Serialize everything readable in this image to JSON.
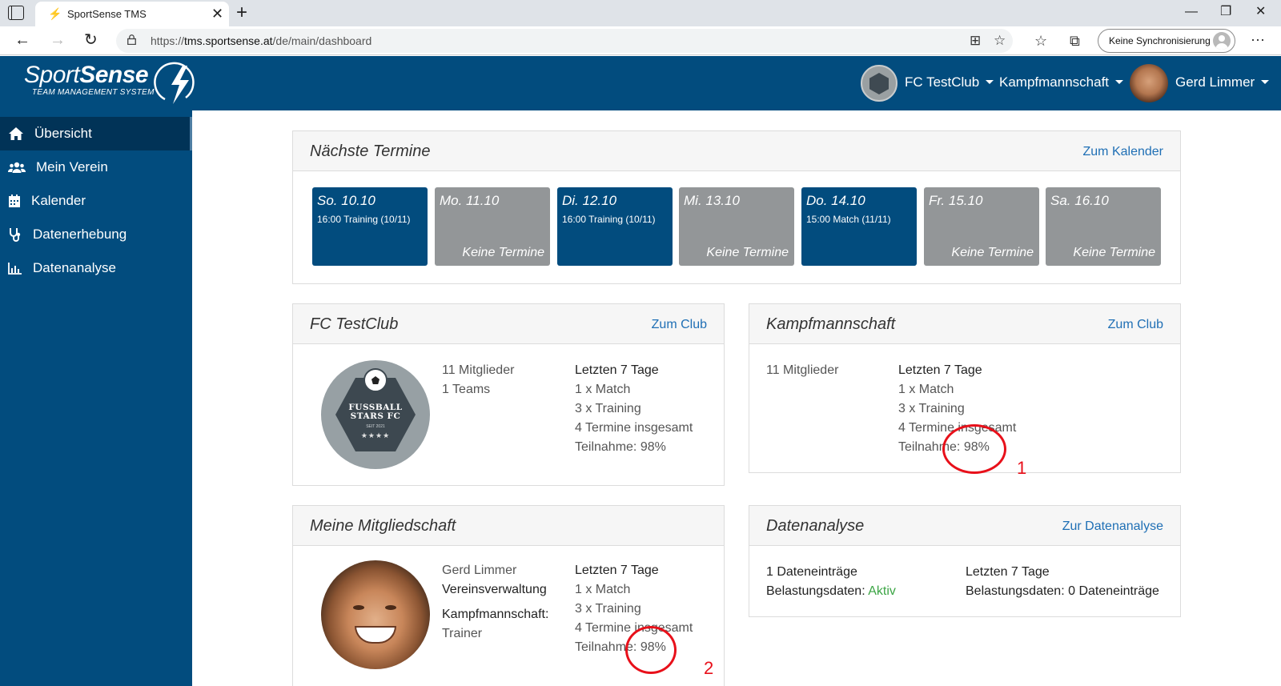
{
  "browser": {
    "tab_title": "SportSense TMS",
    "url_prefix": "https://",
    "url_host": "tms.sportsense.at",
    "url_path": "/de/main/dashboard",
    "sync_label": "Keine Synchronisierung"
  },
  "header": {
    "logo_thin": "Sport",
    "logo_bold": "Sense",
    "logo_sub": "TEAM MANAGEMENT SYSTEM",
    "club": "FC TestClub",
    "team": "Kampfmannschaft",
    "user": "Gerd Limmer"
  },
  "sidebar": {
    "items": [
      {
        "label": "Übersicht",
        "icon": "home-icon",
        "active": true
      },
      {
        "label": "Mein Verein",
        "icon": "users-icon"
      },
      {
        "label": "Kalender",
        "icon": "calendar-icon"
      },
      {
        "label": "Datenerhebung",
        "icon": "stethoscope-icon"
      },
      {
        "label": "Datenanalyse",
        "icon": "bar-chart-icon"
      }
    ]
  },
  "termine": {
    "title": "Nächste Termine",
    "link": "Zum Kalender",
    "days": [
      {
        "date": "So. 10.10",
        "event": "16:00 Training (10/11)",
        "none": ""
      },
      {
        "date": "Mo. 11.10",
        "event": "",
        "none": "Keine Termine"
      },
      {
        "date": "Di. 12.10",
        "event": "16:00 Training (10/11)",
        "none": ""
      },
      {
        "date": "Mi. 13.10",
        "event": "",
        "none": "Keine Termine"
      },
      {
        "date": "Do. 14.10",
        "event": "15:00 Match (11/11)",
        "none": ""
      },
      {
        "date": "Fr. 15.10",
        "event": "",
        "none": "Keine Termine"
      },
      {
        "date": "Sa. 16.10",
        "event": "",
        "none": "Keine Termine"
      }
    ]
  },
  "club_card": {
    "title": "FC TestClub",
    "link": "Zum Club",
    "logo_name_1": "FUSSBALL",
    "logo_name_2": "STARS FC",
    "logo_since": "SEIT 2021",
    "logo_stars": "★★★★",
    "members": "11 Mitglieder",
    "teams": "1 Teams",
    "stats_title": "Letzten 7 Tage",
    "match": "1 x Match",
    "training": "3 x Training",
    "total": "4 Termine insgesamt",
    "participation": "Teilnahme: 98%"
  },
  "team_card": {
    "title": "Kampfmannschaft",
    "link": "Zum Club",
    "members": "11 Mitglieder",
    "stats_title": "Letzten 7 Tage",
    "match": "1 x Match",
    "training": "3 x Training",
    "total": "4 Termine insgesamt",
    "participation": "Teilnahme: 98%"
  },
  "membership_card": {
    "title": "Meine Mitgliedschaft",
    "name": "Gerd Limmer",
    "role_admin": "Vereinsverwaltung",
    "team_label": "Kampfmannschaft:",
    "team_role": "Trainer",
    "stats_title": "Letzten 7 Tage",
    "match": "1 x Match",
    "training": "3 x Training",
    "total": "4 Termine insgesamt",
    "participation": "Teilnahme: 98%"
  },
  "analysis_card": {
    "title": "Datenanalyse",
    "link": "Zur Datenanalyse",
    "entries": "1 Dateneinträge",
    "load_label": "Belastungsdaten: ",
    "load_status": "Aktiv",
    "stats_title": "Letzten 7 Tage",
    "load_entries": "Belastungsdaten: 0 Dateneinträge"
  },
  "annotations": {
    "one": "1",
    "two": "2"
  },
  "colors": {
    "brand": "#024c7e",
    "link": "#1f6fb5",
    "day_empty": "#939698",
    "active_green": "#3ca545",
    "annotation": "#e8101a"
  }
}
